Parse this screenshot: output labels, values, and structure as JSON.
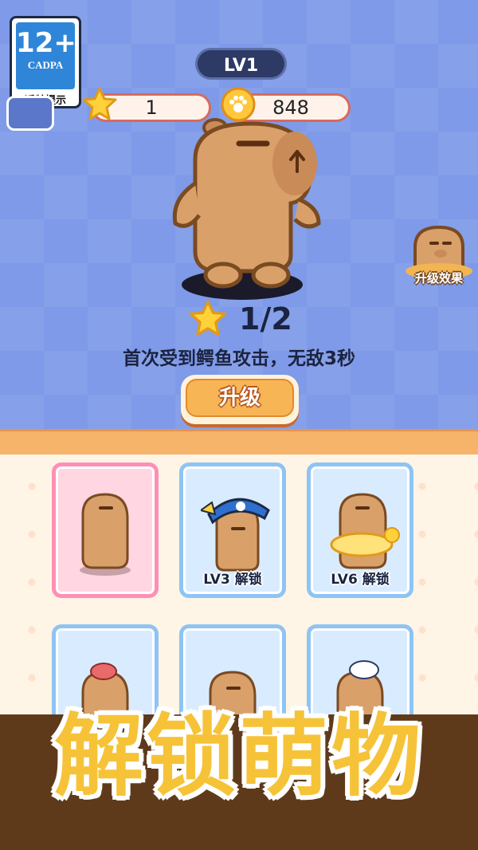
{
  "age_rating": {
    "number": "12+",
    "org": "CADPA",
    "tip": "适龄提示"
  },
  "header": {
    "level": "LV1",
    "stars": "1",
    "coins": "848"
  },
  "pet": {
    "level_progress": "1/2",
    "description": "首次受到鳄鱼攻击，无敌3秒"
  },
  "side_button": {
    "label": "升级效果"
  },
  "upgrade_button": {
    "label": "升级"
  },
  "cards": [
    {
      "caption": "",
      "selected": true
    },
    {
      "caption": "LV3 解锁",
      "selected": false
    },
    {
      "caption": "LV6 解锁",
      "selected": false
    },
    {
      "caption": "",
      "selected": false
    },
    {
      "caption": "",
      "selected": false
    },
    {
      "caption": "",
      "selected": false
    }
  ],
  "banner": {
    "text": "解锁萌物"
  },
  "colors": {
    "sky": "#7e9ae8",
    "capybara": "#d9a06a",
    "accent_orange": "#f7b556",
    "banner_text": "#f6c338",
    "card_selected": "#ff8fb6",
    "card_locked": "#8ec4f4"
  }
}
